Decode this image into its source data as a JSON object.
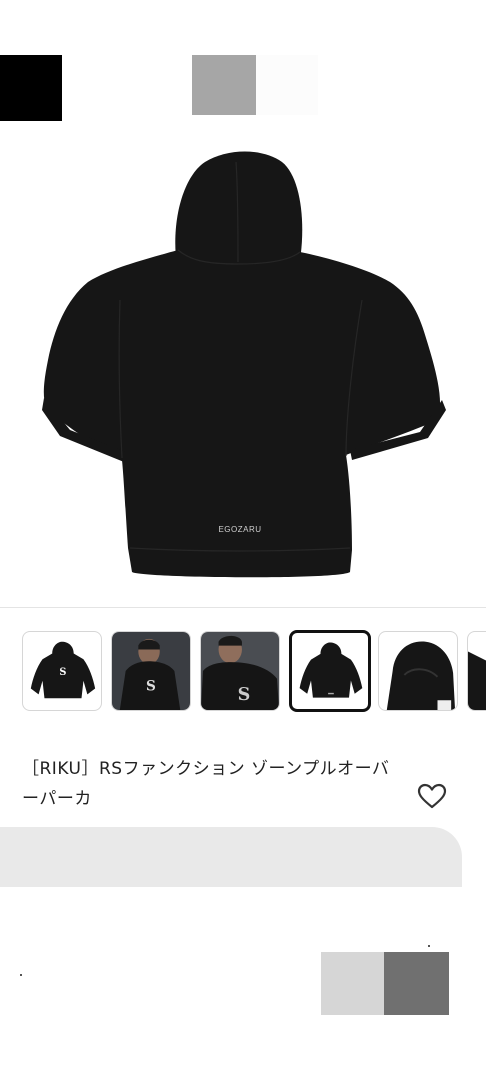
{
  "product": {
    "title": "［RIKU］RSファンクション ゾーンプルオーバーパーカ",
    "brand_print": "EGOZARU"
  },
  "gallery": {
    "selected_index": 3,
    "thumbnails": [
      {
        "name": "thumb-front"
      },
      {
        "name": "thumb-model-front"
      },
      {
        "name": "thumb-model-closeup"
      },
      {
        "name": "thumb-back"
      },
      {
        "name": "thumb-hood-detail"
      },
      {
        "name": "thumb-partial"
      }
    ]
  },
  "icons": {
    "favorite": "heart-outline-icon"
  },
  "colors": {
    "garment": "#161616",
    "skeleton": "#e9e9e9",
    "selected_border": "#111111"
  }
}
